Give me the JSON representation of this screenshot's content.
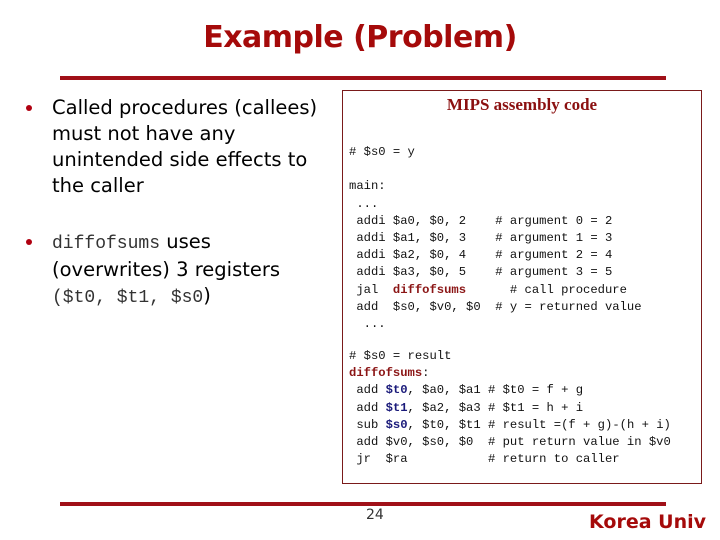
{
  "slide": {
    "title": "Example (Problem)",
    "page_number": "24",
    "brand": "Korea Univ",
    "accent_color": "#a50a0a"
  },
  "bullets": [
    {
      "text": "Called procedures (callees) must not have any unintended side effects to the caller"
    },
    {
      "code_prefix": "diffofsums",
      "text_mid": " uses (overwrites) 3 registers ",
      "code_suffix": "($t0, $t1, $s0",
      "text_end": ")"
    }
  ],
  "code_box": {
    "heading": "MIPS assembly code",
    "main_lines": [
      {
        "text": "# $s0 = y"
      },
      {
        "text": ""
      },
      {
        "text": "main:"
      },
      {
        "text": " ..."
      },
      {
        "text": " addi $a0, $0, 2    # argument 0 = 2"
      },
      {
        "text": " addi $a1, $0, 3    # argument 1 = 3"
      },
      {
        "text": " addi $a2, $0, 4    # argument 2 = 4"
      },
      {
        "text": " addi $a3, $0, 5    # argument 3 = 5"
      },
      {
        "pre": " jal  ",
        "fn": "diffofsums",
        "post": "      # call procedure"
      },
      {
        "text": " add  $s0, $v0, $0  # y = returned value"
      },
      {
        "text": "  ..."
      }
    ],
    "proc_lines": [
      {
        "text": "# $s0 = result"
      },
      {
        "fn": "diffofsums",
        "post": ":"
      },
      {
        "pre": " add ",
        "reg": "$t0",
        "post": ", $a0, $a1 # $t0 = f + g"
      },
      {
        "pre": " add ",
        "reg": "$t1",
        "post": ", $a2, $a3 # $t1 = h + i"
      },
      {
        "pre": " sub ",
        "reg": "$s0",
        "post": ", $t0, $t1 # result =(f + g)-(h + i)"
      },
      {
        "text": " add $v0, $s0, $0  # put return value in $v0"
      },
      {
        "text": " jr  $ra           # return to caller"
      }
    ]
  }
}
